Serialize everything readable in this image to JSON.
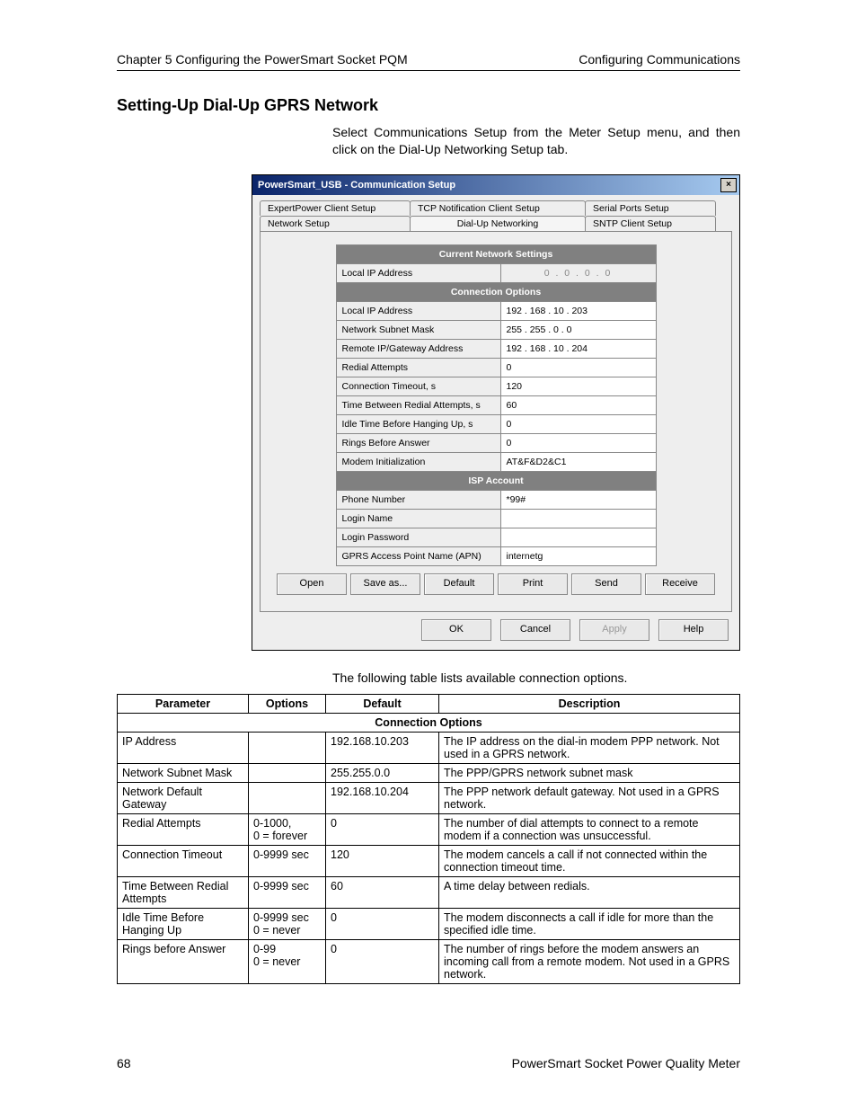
{
  "header": {
    "left": "Chapter 5 Configuring the PowerSmart Socket PQM",
    "right": "Configuring Communications"
  },
  "section_title": "Setting-Up Dial-Up GPRS Network",
  "intro": "Select Communications Setup from the Meter Setup menu, and then click on the Dial-Up Networking Setup tab.",
  "dialog": {
    "title": "PowerSmart_USB - Communication Setup",
    "tabs_top": [
      "ExpertPower Client Setup",
      "TCP Notification Client Setup",
      "Serial Ports Setup"
    ],
    "tabs_bottom": [
      "Network Setup",
      "Dial-Up Networking",
      "SNTP Client Setup"
    ],
    "selected_tab": "Dial-Up Networking",
    "sections": {
      "current": {
        "title": "Current Network Settings",
        "rows": [
          {
            "label": "Local IP Address",
            "value": "0 . 0 . 0 . 0",
            "readonly": true
          }
        ]
      },
      "conn": {
        "title": "Connection Options",
        "rows": [
          {
            "label": "Local IP Address",
            "value": "192 . 168 . 10 . 203"
          },
          {
            "label": "Network Subnet Mask",
            "value": "255 . 255 . 0  . 0"
          },
          {
            "label": "Remote IP/Gateway Address",
            "value": "192 . 168 . 10 . 204"
          },
          {
            "label": "Redial Attempts",
            "value": "0"
          },
          {
            "label": "Connection Timeout, s",
            "value": "120"
          },
          {
            "label": "Time Between Redial Attempts, s",
            "value": "60"
          },
          {
            "label": "Idle Time Before Hanging Up, s",
            "value": "0"
          },
          {
            "label": "Rings Before Answer",
            "value": "0"
          },
          {
            "label": "Modem Initialization",
            "value": "AT&F&D2&C1"
          }
        ]
      },
      "isp": {
        "title": "ISP Account",
        "rows": [
          {
            "label": "Phone Number",
            "value": "*99#"
          },
          {
            "label": "Login Name",
            "value": ""
          },
          {
            "label": "Login Password",
            "value": ""
          },
          {
            "label": "GPRS Access Point Name (APN)",
            "value": "internetg"
          }
        ]
      }
    },
    "action_buttons": [
      "Open",
      "Save as...",
      "Default",
      "Print",
      "Send",
      "Receive"
    ],
    "bottom_buttons": [
      "OK",
      "Cancel",
      "Apply",
      "Help"
    ]
  },
  "post_line": "The following table lists available connection options.",
  "param_table": {
    "headers": [
      "Parameter",
      "Options",
      "Default",
      "Description"
    ],
    "section_header": "Connection Options",
    "rows": [
      {
        "p": "IP Address",
        "o": "",
        "d": "192.168.10.203",
        "desc": "The IP address on the dial-in modem PPP network. Not used in a GPRS network."
      },
      {
        "p": "Network Subnet Mask",
        "o": "",
        "d": "255.255.0.0",
        "desc": "The PPP/GPRS network subnet mask"
      },
      {
        "p": "Network Default Gateway",
        "o": "",
        "d": "192.168.10.204",
        "desc": "The PPP network default gateway. Not used in a GPRS network."
      },
      {
        "p": "Redial Attempts",
        "o": "0-1000,\n0 = forever",
        "d": "0",
        "desc": "The number of dial attempts to connect to a remote modem if a connection was unsuccessful."
      },
      {
        "p": "Connection Timeout",
        "o": "0-9999 sec",
        "d": "120",
        "desc": "The modem cancels a call if not connected within the connection timeout time."
      },
      {
        "p": "Time Between Redial Attempts",
        "o": "0-9999 sec",
        "d": "60",
        "desc": "A time delay between redials."
      },
      {
        "p": "Idle Time Before Hanging Up",
        "o": "0-9999 sec\n0 = never",
        "d": "0",
        "desc": "The modem disconnects a call if idle for more than the specified idle time."
      },
      {
        "p": "Rings before Answer",
        "o": "0-99\n0 = never",
        "d": "0",
        "desc": "The number of rings before the modem answers an incoming call from a remote modem. Not used in a GPRS network."
      }
    ]
  },
  "footer": {
    "page": "68",
    "doc": "PowerSmart Socket Power Quality Meter"
  }
}
